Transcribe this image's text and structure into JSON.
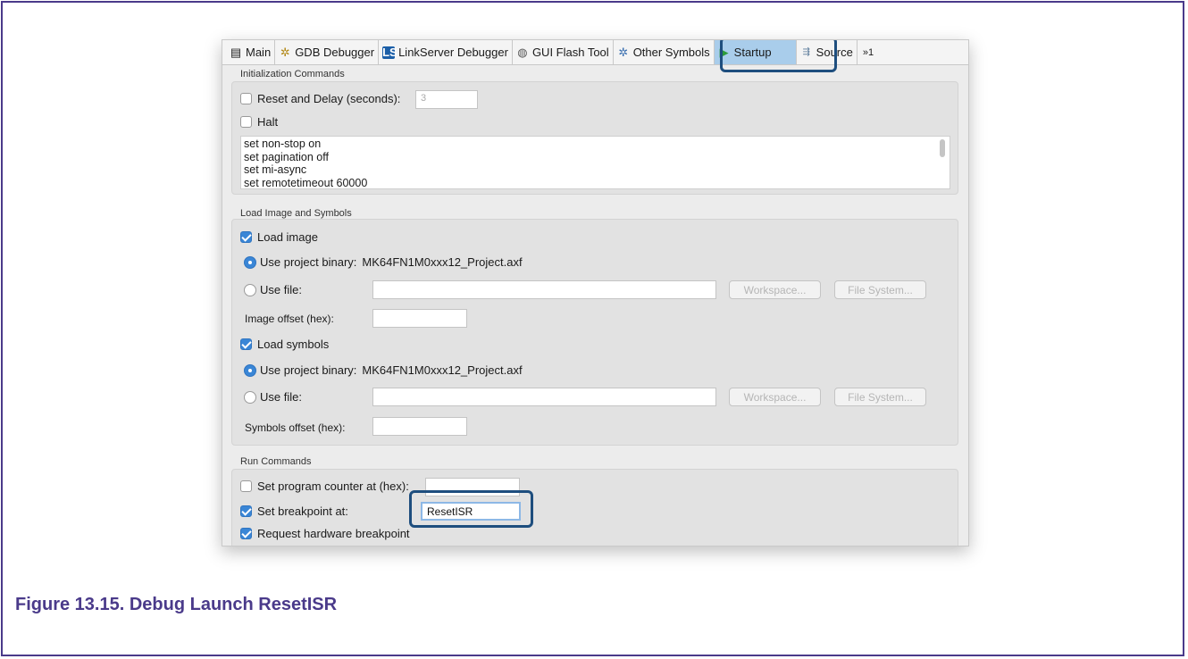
{
  "tabs": [
    {
      "label": "Main",
      "icon": "page-icon"
    },
    {
      "label": "GDB Debugger",
      "icon": "bug-icon"
    },
    {
      "label": "LinkServer Debugger",
      "icon": "ls-icon",
      "icon_text": "LS"
    },
    {
      "label": "GUI Flash Tool",
      "icon": "flash-icon"
    },
    {
      "label": "Other Symbols",
      "icon": "bug-icon"
    },
    {
      "label": "Startup",
      "icon": "play-icon"
    },
    {
      "label": "Source",
      "icon": "source-icon"
    }
  ],
  "tabs_overflow": "»1",
  "init": {
    "title": "Initialization Commands",
    "reset_label": "Reset and Delay (seconds):",
    "reset_value": "3",
    "halt_label": "Halt",
    "commands": [
      "set non-stop on",
      "set pagination off",
      "set mi-async",
      "set remotetimeout 60000"
    ]
  },
  "load": {
    "title": "Load Image and Symbols",
    "load_image_label": "Load image",
    "use_project_binary_label": "Use project binary:",
    "project_binary": "MK64FN1M0xxx12_Project.axf",
    "use_file_label": "Use file:",
    "workspace_label": "Workspace...",
    "filesystem_label": "File System...",
    "image_offset_label": "Image offset (hex):",
    "load_symbols_label": "Load symbols",
    "symbols_offset_label": "Symbols offset (hex):"
  },
  "run": {
    "title": "Run Commands",
    "set_pc_label": "Set program counter at (hex):",
    "set_bp_label": "Set breakpoint at:",
    "bp_value": "ResetISR",
    "hw_bp_label": "Request hardware breakpoint"
  },
  "caption": "Figure 13.15. Debug Launch ResetISR",
  "colors": {
    "accent": "#3a86d6",
    "highlight": "#1e4e7e",
    "caption": "#4a3a8a"
  }
}
